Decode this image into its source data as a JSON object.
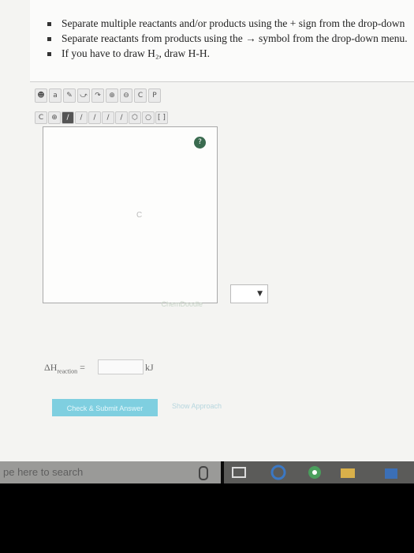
{
  "instructions": {
    "items": [
      {
        "text": "Separate multiple reactants and/or products using the + sign from the drop-down"
      },
      {
        "text": "Separate reactants from products using the → symbol from the drop-down menu."
      },
      {
        "text": "If you have to draw H₂, draw H-H."
      }
    ]
  },
  "editor": {
    "toolbar1": [
      "☻",
      "a",
      "✎",
      "⤻",
      "↷",
      "⊕",
      "⊖",
      "C",
      "P"
    ],
    "toolbar2": [
      "C",
      "⊕",
      "/",
      "/",
      "/",
      "/",
      "/",
      "⬡",
      "○",
      "[ ]"
    ],
    "canvas_atom": "C",
    "logo": "ChemDoodle",
    "help_icon": "?"
  },
  "dropdown": {
    "selected": ""
  },
  "delta_h": {
    "label_main": "ΔH",
    "label_sub": "reaction",
    "equals": "=",
    "value": "",
    "unit": "kJ"
  },
  "buttons": {
    "submit": "Check & Submit Answer",
    "approach": "Show Approach"
  },
  "taskbar": {
    "search_placeholder": "pe here to search"
  }
}
